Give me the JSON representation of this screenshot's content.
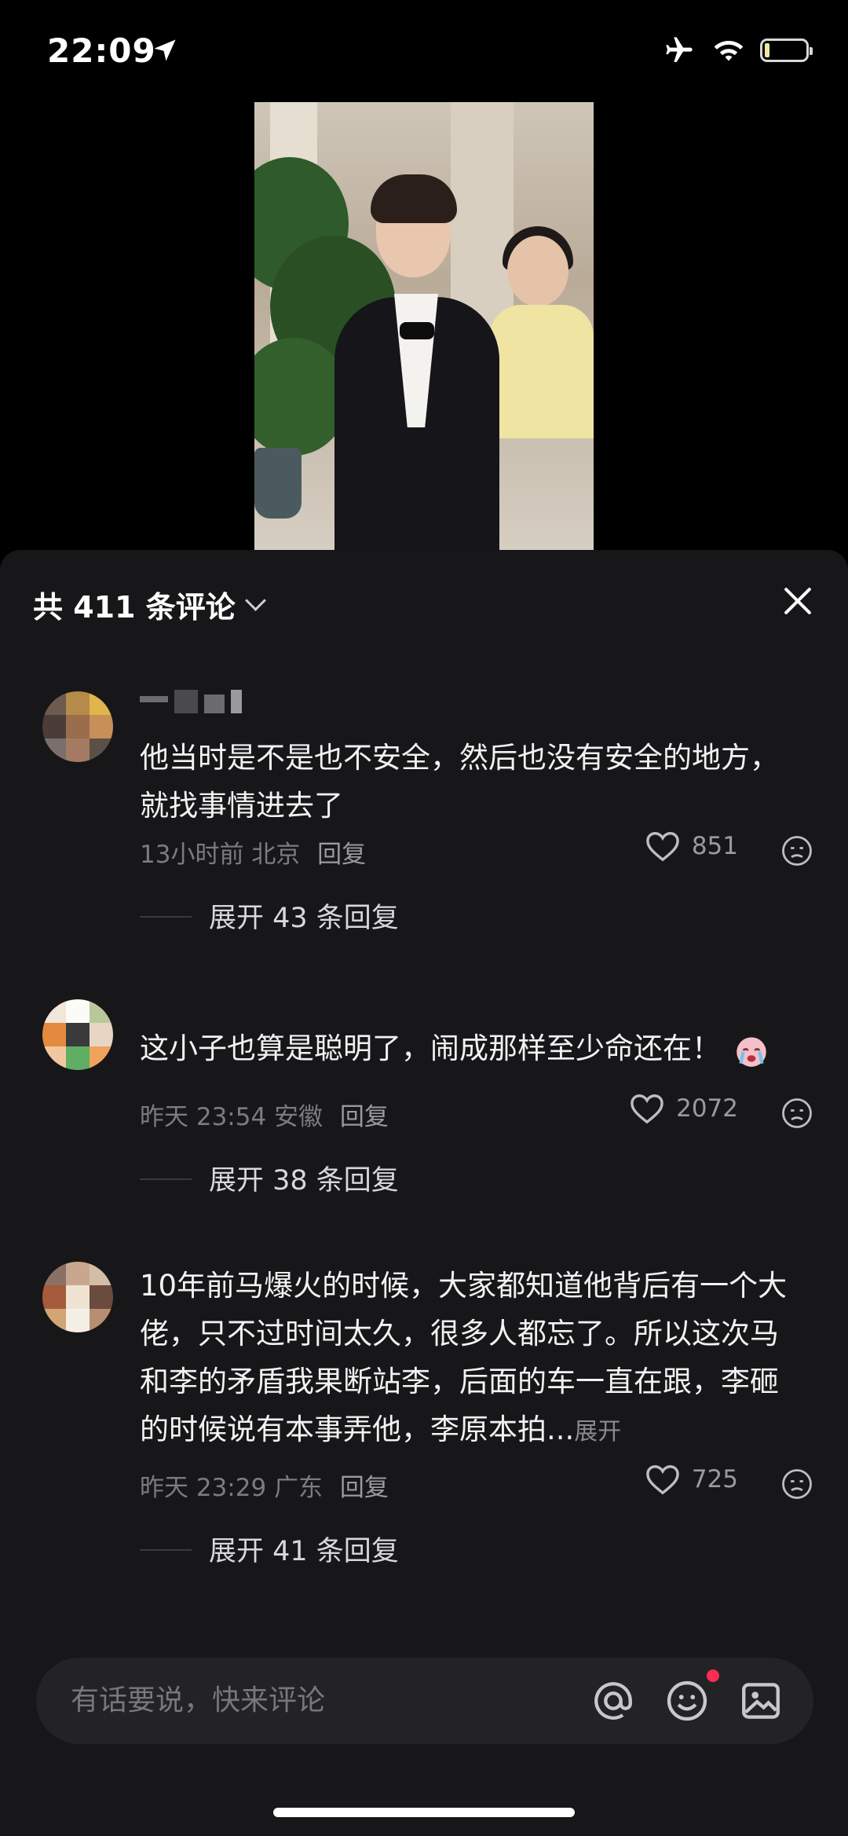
{
  "status_bar": {
    "time": "22:09"
  },
  "sheet": {
    "title": "共 411 条评论"
  },
  "comments": [
    {
      "text": "他当时是不是也不安全，然后也没有安全的地方，就找事情进去了",
      "time": "13小时前",
      "location": "北京",
      "reply_label": "回复",
      "likes": "851",
      "expand": "展开 43 条回复"
    },
    {
      "text": "这小子也算是聪明了，闹成那样至少命还在！",
      "time": "昨天 23:54",
      "location": "安徽",
      "reply_label": "回复",
      "likes": "2072",
      "expand": "展开 38 条回复"
    },
    {
      "text": "10年前马爆火的时候，大家都知道他背后有一个大佬，只不过时间太久，很多人都忘了。所以这次马和李的矛盾我果断站李，后面的车一直在跟，李砸的时候说有本事弄他，李原本拍...",
      "more": "展开",
      "time": "昨天 23:29",
      "location": "广东",
      "reply_label": "回复",
      "likes": "725",
      "expand": "展开 41 条回复"
    }
  ],
  "input": {
    "placeholder": "有话要说，快来评论"
  },
  "colors": {
    "notification_dot": "#ff2b55",
    "sheet_bg": "#171719"
  },
  "icons": [
    "location-arrow-icon",
    "airplane-icon",
    "wifi-icon",
    "battery-icon",
    "chevron-down-icon",
    "close-icon",
    "heart-icon",
    "dislike-face-icon",
    "crying-emoji-icon",
    "at-icon",
    "emoji-icon",
    "image-icon"
  ]
}
